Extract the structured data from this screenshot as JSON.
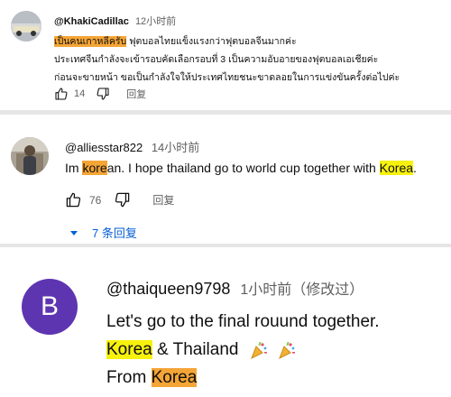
{
  "comment1": {
    "handle": "@KhakiCadillac",
    "time": "12小时前",
    "highlight": "เป็นคนเกาหลีครับ",
    "line1_rest": " ฟุตบอลไทยแข็งแรงกว่าฟุตบอลจีนมากค่ะ",
    "line2": "ประเทศจีนกำลังจะเข้ารอบคัดเลือกรอบที่ 3 เป็นความอับอายของฟุตบอลเอเชียค่ะ",
    "line3": "ก่อนจะขายหน้า ขอเป็นกำลังใจให้ประเทศไทยชนะขาดลอยในการแข่งขันครั้งต่อไปค่ะ",
    "likes": "14",
    "reply_label": "回复"
  },
  "comment2": {
    "handle": "@alliesstar822",
    "time": "14小时前",
    "text_before": "Im ",
    "hl1": "kore",
    "text_mid1": "an. I hope thailand go to world cup together with ",
    "hl2": "Korea",
    "text_end": ".",
    "likes": "76",
    "reply_label": "回复",
    "replies_label": "7 条回复"
  },
  "comment3": {
    "avatar_letter": "B",
    "handle": "@thaiqueen9798",
    "time": "1小时前（修改过）",
    "line1": "Let's go to the final  rouund together.",
    "line2_hl": "Korea",
    "line2_rest": " & Thailand",
    "line3_pre": "From ",
    "line3_hl": "Korea",
    "emoji": "party-popper-icon"
  },
  "colors": {
    "highlight_yellow": "#f7f10e",
    "highlight_orange": "#f4a536",
    "link_blue": "#065fd4",
    "avatar_purple": "#5e35b1",
    "divider": "#e6e6e6"
  }
}
